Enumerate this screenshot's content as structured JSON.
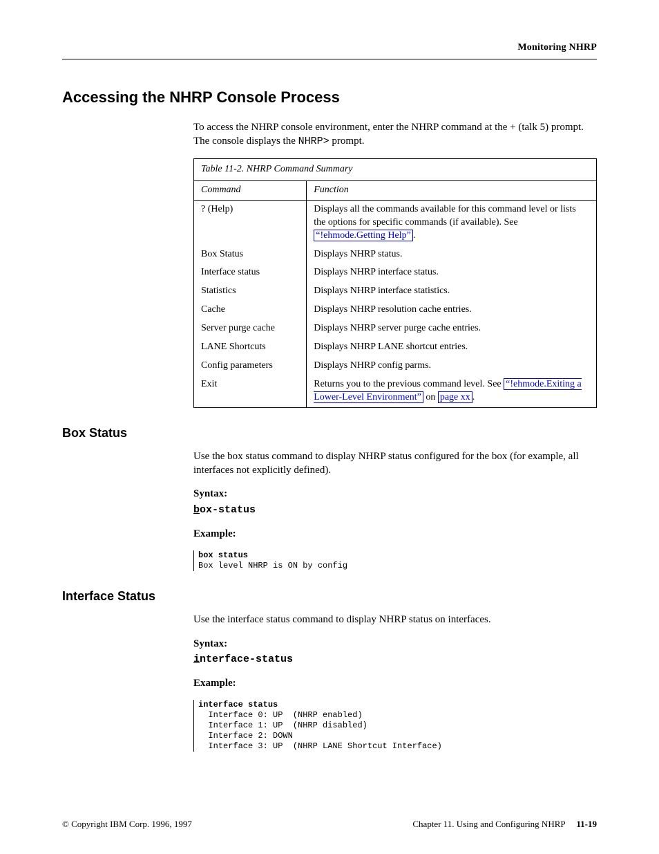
{
  "running_head": "Monitoring NHRP",
  "section_title": "Accessing the NHRP Console Process",
  "para1_pre": "To access the NHRP console environment, enter the NHRP command at the + (talk 5) prompt. The console displays the ",
  "para1_prompt": "NHRP>",
  "para1_post": " prompt.",
  "table": {
    "caption_label": "Table 11-2.",
    "caption_text": "NHRP Command Summary",
    "col1_header": "Command",
    "col2_header": "Function",
    "rows": [
      {
        "cmd": "? (Help)",
        "func_pre": "Displays all the commands available for this command level or lists the options for specific commands (if available). See ",
        "func_link": "“!ehmode.Getting Help”",
        "func_post": "."
      },
      {
        "cmd": "Box Status",
        "func": "Displays NHRP status."
      },
      {
        "cmd": "Interface status",
        "func": "Displays NHRP interface status."
      },
      {
        "cmd": "Statistics",
        "func": "Displays NHRP interface statistics."
      },
      {
        "cmd": "Cache",
        "func": "Displays NHRP resolution cache entries."
      },
      {
        "cmd": "Server purge cache",
        "func": "Displays NHRP server purge cache entries."
      },
      {
        "cmd": "LANE Shortcuts",
        "func": "Displays NHRP LANE shortcut entries."
      },
      {
        "cmd": "Config parameters",
        "func": "Displays NHRP config parms."
      },
      {
        "cmd": "Exit",
        "func_pre": "Returns you to the previous command level. See ",
        "func_link": "“!ehmode.Exiting a Lower-Level Environment”",
        "func_ref": "page xx",
        "func_post": "."
      }
    ]
  },
  "box_status": {
    "heading": "Box Status",
    "desc": "Use the box status command to display NHRP status configured for the box (for example, all interfaces not explicitly defined).",
    "syntax_label": "Syntax:",
    "syntax_key": "b",
    "syntax_rest": "ox-status",
    "example_label": "Example:",
    "example_cmd": "box status",
    "example_out": "Box level NHRP is ON by config"
  },
  "interface_status": {
    "heading": "Interface Status",
    "desc": "Use the interface status command to display NHRP status on interfaces.",
    "syntax_label": "Syntax:",
    "syntax_key": "i",
    "syntax_rest": "nterface-status",
    "example_label": "Example:",
    "example_cmd": "interface status",
    "example_lines": [
      "  Interface 0: UP  (NHRP enabled)",
      "  Interface 1: UP  (NHRP disabled)",
      "  Interface 2: DOWN",
      "  Interface 3: UP  (NHRP LANE Shortcut Interface)"
    ]
  },
  "footer": {
    "copyright": "© Copyright IBM Corp. 1996, 1997",
    "chapter": "Chapter 11.  Using and Configuring NHRP",
    "pageno": "11-19"
  }
}
